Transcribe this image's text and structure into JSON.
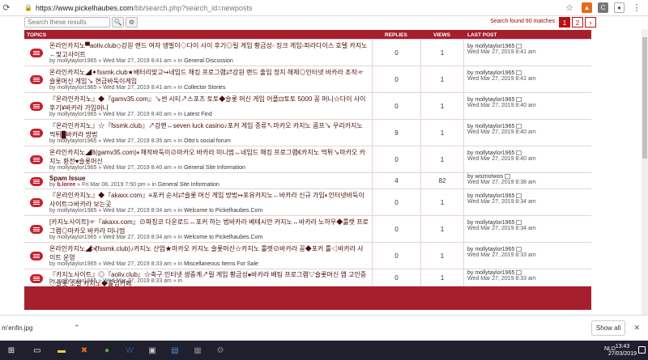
{
  "browser": {
    "url_host": "https://www.pickelhaubes.com",
    "url_path": "/bb/search.php?search_id=newposts",
    "ext_a": "C"
  },
  "search": {
    "placeholder": "Search these results",
    "found": "Search found 90 matches",
    "pages": [
      "1",
      "2"
    ],
    "next": "›"
  },
  "table": {
    "headers": {
      "topics": "TOPICS",
      "replies": "REPLIES",
      "views": "VIEWS",
      "last_post": "LAST POST"
    },
    "rows": [
      {
        "title": "온라인카지노▀aoliv.club◇강원 랜드 여자 앵벌이◇다이 사이 후기◎릴 게임 황금성◦ 징크 게임◦파라다이스 호텔 카지노←맞고사이트",
        "by": "by",
        "author": "mollytaylor1965",
        "sep": " » ",
        "date": "Wed Mar 27, 2019 8:41 am",
        "in": " » in ",
        "forum": "General Discussion",
        "replies": "0",
        "views": "1",
        "lp_author": "by mollytaylor1965",
        "lp_date": "Wed Mar 27, 2019 8:41 am"
      },
      {
        "title": "온라인카지노◢✦fssmk.club★배터리맞고↪네임드 해킹 프로그램⇄강원 랜드 출입 정지 해제◎인터넷 바카라 조작☞슬롯머신 게임↘ 현금바둑이게임",
        "by": "by",
        "author": "mollytaylor1965",
        "sep": " » ",
        "date": "Wed Mar 27, 2019 8:41 am",
        "in": " » in ",
        "forum": "Collector Stories",
        "replies": "0",
        "views": "1",
        "lp_author": "by mollytaylor1965",
        "lp_date": "Wed Mar 27, 2019 8:41 am"
      },
      {
        "title": "『온라인카지노』◆『gamv35.com』↘썬 시티↗스포츠 토토◆슬롯 머신 게임 어플⊡토토 5000 꽁 머니☆다이 사이 후기¥바카라 가입머니",
        "by": "by",
        "author": "mollytaylor1965",
        "sep": " » ",
        "date": "Wed Mar 27, 2019 8:40 am",
        "in": " » in ",
        "forum": "Latest Find",
        "replies": "0",
        "views": "1",
        "lp_author": "by mollytaylor1965",
        "lp_date": "Wed Mar 27, 2019 8:40 am"
      },
      {
        "title": "『온라인카지노』☆『fssmk.club』↗강랜↔seven luck casino♪포커 게임 종류↖마카오 카지노 콤프↘ 우리카지노 먹튀█바카라 방법",
        "by": "by",
        "author": "mollytaylor1965",
        "sep": " » ",
        "date": "Wed Mar 27, 2019 8:35 am",
        "in": " » in ",
        "forum": "Otto's social forum",
        "replies": "9",
        "views": "1",
        "lp_author": "by mollytaylor1965",
        "lp_date": "Wed Mar 27, 2019 8:40 am"
      },
      {
        "title": "온라인카지노◢8(gamv35.com)◐해적바둑이⊘마카오 바카라 미니멈↔네임드 해킹 프로그램€카지노 먹튀↘마카오 카지노 환전♥슬롯머신",
        "by": "by",
        "author": "mollytaylor1965",
        "sep": " » ",
        "date": "Wed Mar 27, 2019 8:40 am",
        "in": " » in ",
        "forum": "General Site Information",
        "replies": "0",
        "views": "1",
        "lp_author": "by mollytaylor1965",
        "lp_date": "Wed Mar 27, 2019 8:40 am"
      },
      {
        "title": "Spam Issue",
        "by": "by",
        "author": "b.loree",
        "sep": " » ",
        "date": "Fri Mar 08, 2019 7:50 pm",
        "in": " » in ",
        "forum": "General Site Information",
        "replies": "4",
        "views": "82",
        "lp_author": "by woznotwos",
        "lp_date": "Wed Mar 27, 2019 8:38 am"
      },
      {
        "title": "『온라인카지노』◆『akaxx.com』≡포커 순서⇄슬롯 머신 게임 방법↣포유카지노←바카라 신규 가입◐인터넷바둑이사이트⇒바카라 보는곳",
        "by": "by",
        "author": "mollytaylor1965",
        "sep": " » ",
        "date": "Wed Mar 27, 2019 8:34 am",
        "in": " » in ",
        "forum": "Welcome to Pickelhaubes.Com",
        "replies": "0",
        "views": "1",
        "lp_author": "by mollytaylor1965",
        "lp_date": "Wed Mar 27, 2019 8:34 am"
      },
      {
        "title": "[카지노사이트]☞『akaxx.com』⊘파칭코 다운로드↔포커 하는 법바카라 베테시안 카지노↔바카라 노하우◆룰렛 프로그램◎마카오 바카라 미니멈",
        "by": "by",
        "author": "mollytaylor1965",
        "sep": " » ",
        "date": "Wed Mar 27, 2019 8:34 am",
        "in": " » in ",
        "forum": "Welcome to Pickelhaubes.Com",
        "replies": "0",
        "views": "1",
        "lp_author": "by mollytaylor1965",
        "lp_date": "Wed Mar 27, 2019 8:34 am"
      },
      {
        "title": "온라인카지노◢≯(fssmk.club)♪카지노 산업★마카오 카지노 슬롯머신☆카지노 룰렛⊘바카라 꽁◆포커 룰◁바카라 사이트 운영",
        "by": "by",
        "author": "mollytaylor1965",
        "sep": " » ",
        "date": "Wed Mar 27, 2019 8:33 am",
        "in": " » in ",
        "forum": "Miscellaneous Items For Sale",
        "replies": "0",
        "views": "1",
        "lp_author": "by mollytaylor1965",
        "lp_date": "Wed Mar 27, 2019 8:33 am"
      },
      {
        "title": "『카지노사이트』◎『aoliv.club』☆축구 인터넷 생중계↗릴 게임 황금성♠바카라 베팅 프로그램▽슬롯머신 앱 고인증◇슬롯 소셜 카지노◆홀덤카페",
        "by": "by",
        "author": "mollytaylor1965",
        "sep": " » ",
        "date": "Wed Mar 27, 2019 8:33 am",
        "in": " » in ",
        "forum": "",
        "replies": "0",
        "views": "1",
        "lp_author": "by mollytaylor1965",
        "lp_date": "Wed Mar 27, 2019 8:33 am"
      }
    ]
  },
  "downloads": {
    "file": "m'enfin.jpg",
    "show_all": "Show all"
  },
  "taskbar": {
    "tray": "NLD",
    "time": "13:43",
    "date": "27/03/2019"
  },
  "colors": {
    "accent": "#a51f2d",
    "taskbar": "#1f1f2e"
  }
}
